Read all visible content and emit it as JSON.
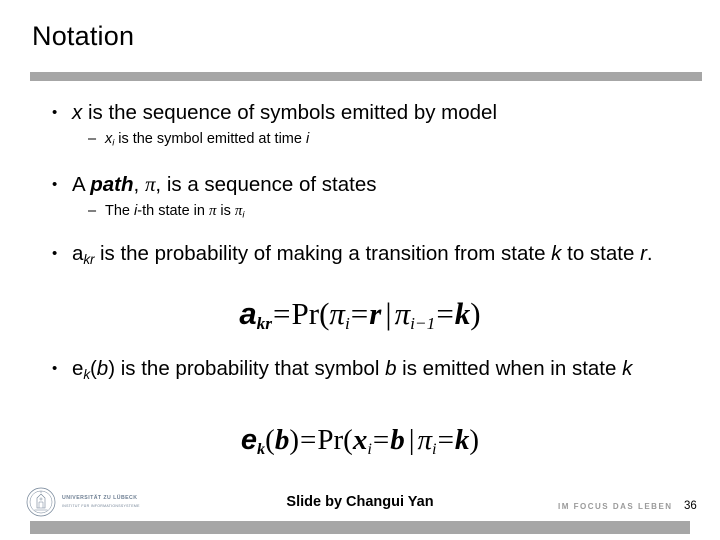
{
  "slide": {
    "title": "Notation",
    "accent_color": "#a6a6a6",
    "background_color": "#ffffff",
    "text_color": "#000000"
  },
  "bullets": {
    "b1": {
      "pre": "",
      "var": "x",
      "text": " is the sequence of symbols emitted by model"
    },
    "b1s1": {
      "var": "x",
      "sub": "i",
      "text": " is the symbol emitted at time ",
      "tail_var": "i"
    },
    "b2": {
      "lead": "A ",
      "bold": "path",
      "mid": ", ",
      "greek": "π",
      "text": ", is a  sequence of states"
    },
    "b2s1": {
      "lead": "The ",
      "var": "i",
      "mid": "-th state in ",
      "greek": "π",
      "mid2": " is ",
      "greek2": "π",
      "sub": "i"
    },
    "b3": {
      "var": "a",
      "sub": "kr",
      "text": " is the probability of making a transition from state ",
      "var2": "k",
      "text2": " to state ",
      "var3": "r",
      "text3": "."
    },
    "b4": {
      "var": "e",
      "sub": "k",
      "text": "(",
      "var2": "b",
      "text2": ") is the probability that symbol ",
      "var3": "b",
      "text3": " is emitted when in state ",
      "var4": "k"
    }
  },
  "equations": {
    "eq1": {
      "lhs_var": "a",
      "lhs_sub": "kr",
      "eq": "=",
      "pr": "Pr(",
      "pi1": "π",
      "pi1_sub": "i",
      "eq2": "=",
      "rhs1": "r",
      "bar": "|",
      "pi2": "π",
      "pi2_sub": "i−1",
      "eq3": "=",
      "rhs2": "k",
      "close": ")",
      "plain": "a_kr = Pr(π_i = r | π_{i−1} = k)"
    },
    "eq2": {
      "lhs_var": "e",
      "lhs_sub": "k",
      "lhs_open": "(",
      "lhs_arg": "b",
      "lhs_close": ")",
      "eq": "=",
      "pr": "Pr(",
      "x": "x",
      "x_sub": "i",
      "eq2": "=",
      "rhs1": "b",
      "bar": "|",
      "pi": "π",
      "pi_sub": "i",
      "eq3": "=",
      "rhs2": "k",
      "close": ")",
      "plain": "e_k(b) = Pr(x_i = b | π_i = k)"
    }
  },
  "footer": {
    "logo_line1": "UNIVERSITÄT ZU LÜBECK",
    "logo_line2": "INSTITUT FÜR INFORMATIONSSYSTEME",
    "logo_color": "#6e7f93",
    "credit": "Slide by Changui Yan",
    "tagline": "IM FOCUS DAS LEBEN",
    "tagline_color": "#9a9a9a",
    "slide_number": "36"
  }
}
